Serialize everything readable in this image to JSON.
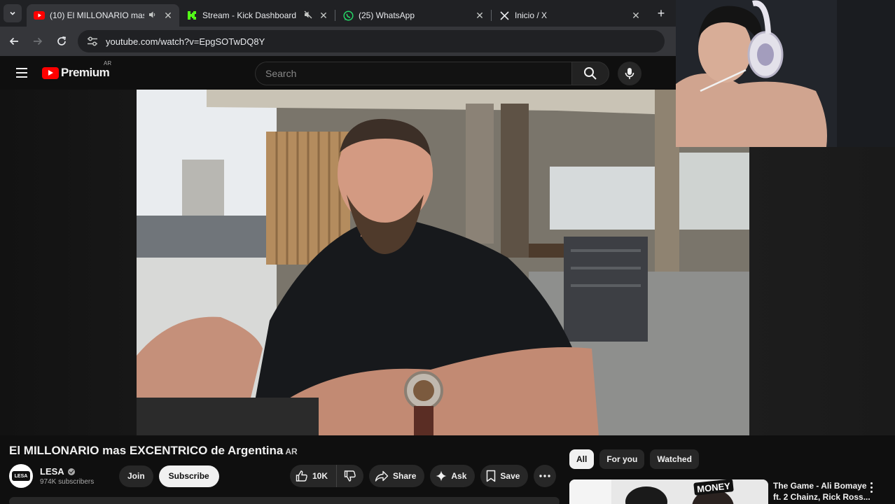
{
  "browser": {
    "tabs": [
      {
        "title": "(10) El MILLONARIO mas EXCENTRICO de Argentina",
        "favicon": "youtube-icon",
        "muted_icon": true,
        "active": true
      },
      {
        "title": "Stream - Kick Dashboard",
        "favicon": "kick-icon",
        "muted_icon": true,
        "active": false
      },
      {
        "title": "(25) WhatsApp",
        "favicon": "whatsapp-icon",
        "muted_icon": false,
        "active": false
      },
      {
        "title": "Inicio / X",
        "favicon": "x-icon",
        "muted_icon": false,
        "active": false
      }
    ],
    "url": "youtube.com/watch?v=EpgSOTwDQ8Y"
  },
  "masthead": {
    "logo_text": "Premium",
    "country_code": "AR",
    "search_placeholder": "Search"
  },
  "video": {
    "title": "El MILLONARIO mas EXCENTRICO de Argentina",
    "title_badge": "AR"
  },
  "channel": {
    "name": "LESA",
    "subscribers": "974K subscribers",
    "avatar_text": "LESA",
    "join_label": "Join",
    "subscribe_label": "Subscribe"
  },
  "actions": {
    "likes": "10K",
    "share_label": "Share",
    "ask_label": "Ask",
    "save_label": "Save"
  },
  "chips": [
    "All",
    "For you",
    "Watched"
  ],
  "recommendation": {
    "title_line1": "The Game - Ali Bomaye",
    "title_line2": "ft. 2 Chainz, Rick Ross...",
    "thumb_text": "MONEY"
  },
  "colors": {
    "youtube_red": "#ff0000",
    "kick_green": "#53fc18",
    "whatsapp_green": "#25d366",
    "page_bg": "#0f0f0f"
  }
}
